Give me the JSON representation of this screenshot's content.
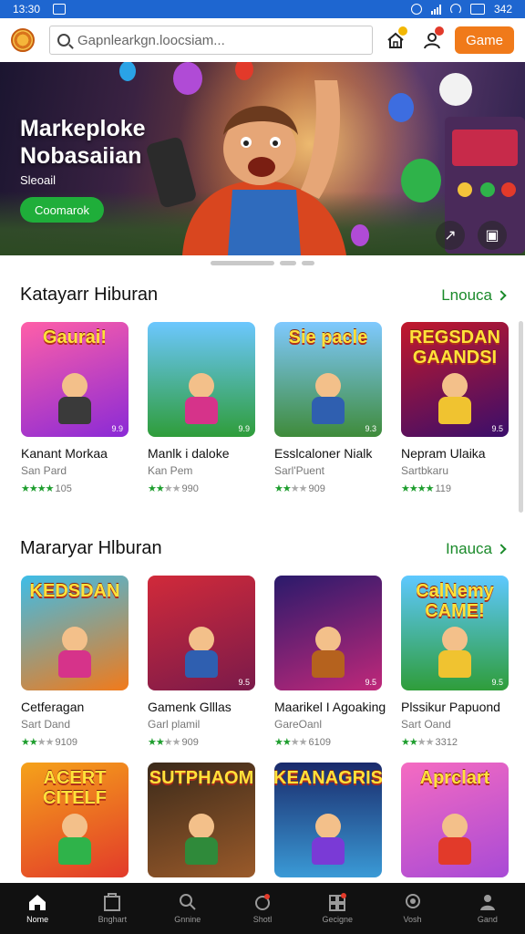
{
  "status_bar": {
    "time": "13:30",
    "battery": "342"
  },
  "header": {
    "search_placeholder": "Gapnlearkgn.loocsiam...",
    "game_button": "Game"
  },
  "banner": {
    "title": "Markeploke Nobasaiian",
    "subtitle": "Sleoail",
    "button": "Coomarok",
    "colors": {
      "button": "#1fae3a"
    }
  },
  "sections": [
    {
      "title": "Katayarr Hiburan",
      "link": "Lnouca",
      "items": [
        {
          "title": "Kanant Morkaa",
          "subtitle": "San Pard",
          "rating": "105",
          "stars": 4,
          "thumb_label": "Gaurai!",
          "thumb_rating": "9.9"
        },
        {
          "title": "Manlk i daloke",
          "subtitle": "Kan Pem",
          "rating": "990",
          "stars": 2,
          "thumb_label": "",
          "thumb_rating": "9.9"
        },
        {
          "title": "Esslcaloner Nialk",
          "subtitle": "Sarl'Puent",
          "rating": "909",
          "stars": 2,
          "thumb_label": "Sie pacle",
          "thumb_rating": "9.3"
        },
        {
          "title": "Nepram Ulaika",
          "subtitle": "Sartbkaru",
          "rating": "119",
          "stars": 4,
          "thumb_label": "REGSDAN GAANDSI",
          "thumb_rating": "9.5"
        }
      ]
    },
    {
      "title": "Mararyar Hlburan",
      "link": "Inauca",
      "items": [
        {
          "title": "Cetferagan",
          "subtitle": "Sart Dand",
          "rating": "9109",
          "stars": 2,
          "thumb_label": "KEDSDAN",
          "thumb_rating": ""
        },
        {
          "title": "Gamenk Glllas",
          "subtitle": "Garl plamil",
          "rating": "909",
          "stars": 2,
          "thumb_label": "",
          "thumb_rating": "9.5"
        },
        {
          "title": "Maarikel I Agoaking",
          "subtitle": "GareOanl",
          "rating": "6109",
          "stars": 2,
          "thumb_label": "",
          "thumb_rating": "9.5"
        },
        {
          "title": "Plssikur Papuond",
          "subtitle": "Sart Oand",
          "rating": "3312",
          "stars": 2,
          "thumb_label": "CalNemy CAME!",
          "thumb_rating": "9.5"
        }
      ]
    },
    {
      "title": "",
      "link": "",
      "items": [
        {
          "title": "",
          "subtitle": "",
          "rating": "",
          "stars": 0,
          "thumb_label": "ACERT CITELF",
          "thumb_rating": ""
        },
        {
          "title": "",
          "subtitle": "",
          "rating": "",
          "stars": 0,
          "thumb_label": "SUTPHAOM",
          "thumb_rating": ""
        },
        {
          "title": "",
          "subtitle": "",
          "rating": "",
          "stars": 0,
          "thumb_label": "KEANAGRIS",
          "thumb_rating": ""
        },
        {
          "title": "",
          "subtitle": "",
          "rating": "",
          "stars": 0,
          "thumb_label": "Aprclart",
          "thumb_rating": ""
        }
      ]
    }
  ],
  "bottom_nav": [
    {
      "label": "Nome",
      "icon": "home-icon",
      "active": true
    },
    {
      "label": "Bnghart",
      "icon": "store-icon",
      "active": false
    },
    {
      "label": "Gnnine",
      "icon": "search-icon",
      "active": false
    },
    {
      "label": "Shotl",
      "icon": "apps-icon",
      "active": false
    },
    {
      "label": "Gecigne",
      "icon": "library-icon",
      "active": false
    },
    {
      "label": "Vosh",
      "icon": "magnifier-icon",
      "active": false
    },
    {
      "label": "Gand",
      "icon": "profile-icon",
      "active": false
    }
  ],
  "colors": {
    "status_bar": "#1e66d0",
    "accent_orange": "#f07a1a",
    "link_green": "#1a8a2a",
    "star_green": "#1e9e2e",
    "nav_bg": "#111111"
  }
}
